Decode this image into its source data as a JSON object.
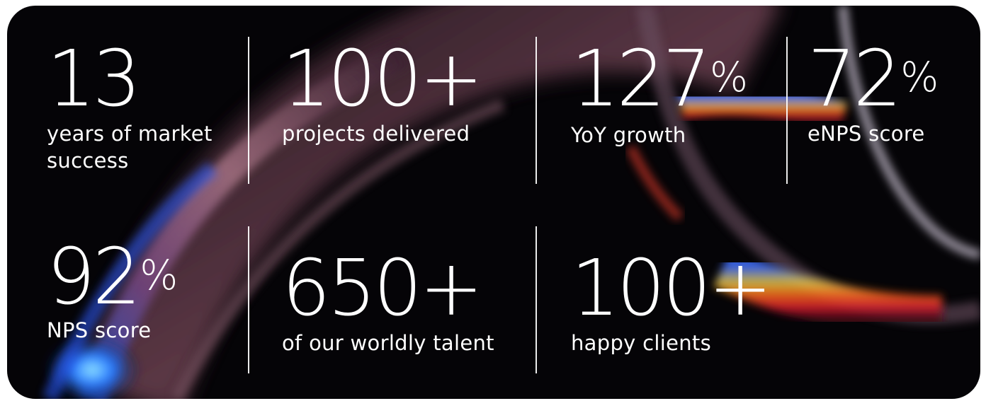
{
  "stats": {
    "years": {
      "value": "13",
      "suffix": "",
      "label": "years of market success"
    },
    "projects": {
      "value": "100+",
      "suffix": "",
      "label": "projects delivered"
    },
    "growth": {
      "value": "127",
      "suffix": "%",
      "label": "YoY growth"
    },
    "enps": {
      "value": "72",
      "suffix": "%",
      "label": "eNPS score"
    },
    "nps": {
      "value": "92",
      "suffix": "%",
      "label": "NPS score"
    },
    "talent": {
      "value": "650+",
      "suffix": "",
      "label": "of our worldly talent"
    },
    "clients": {
      "value": "100+",
      "suffix": "",
      "label": "happy clients"
    }
  },
  "colors": {
    "background": "#050407",
    "text": "#ffffff",
    "accent_red": "#e0263a",
    "accent_blue": "#1f5bd8"
  }
}
